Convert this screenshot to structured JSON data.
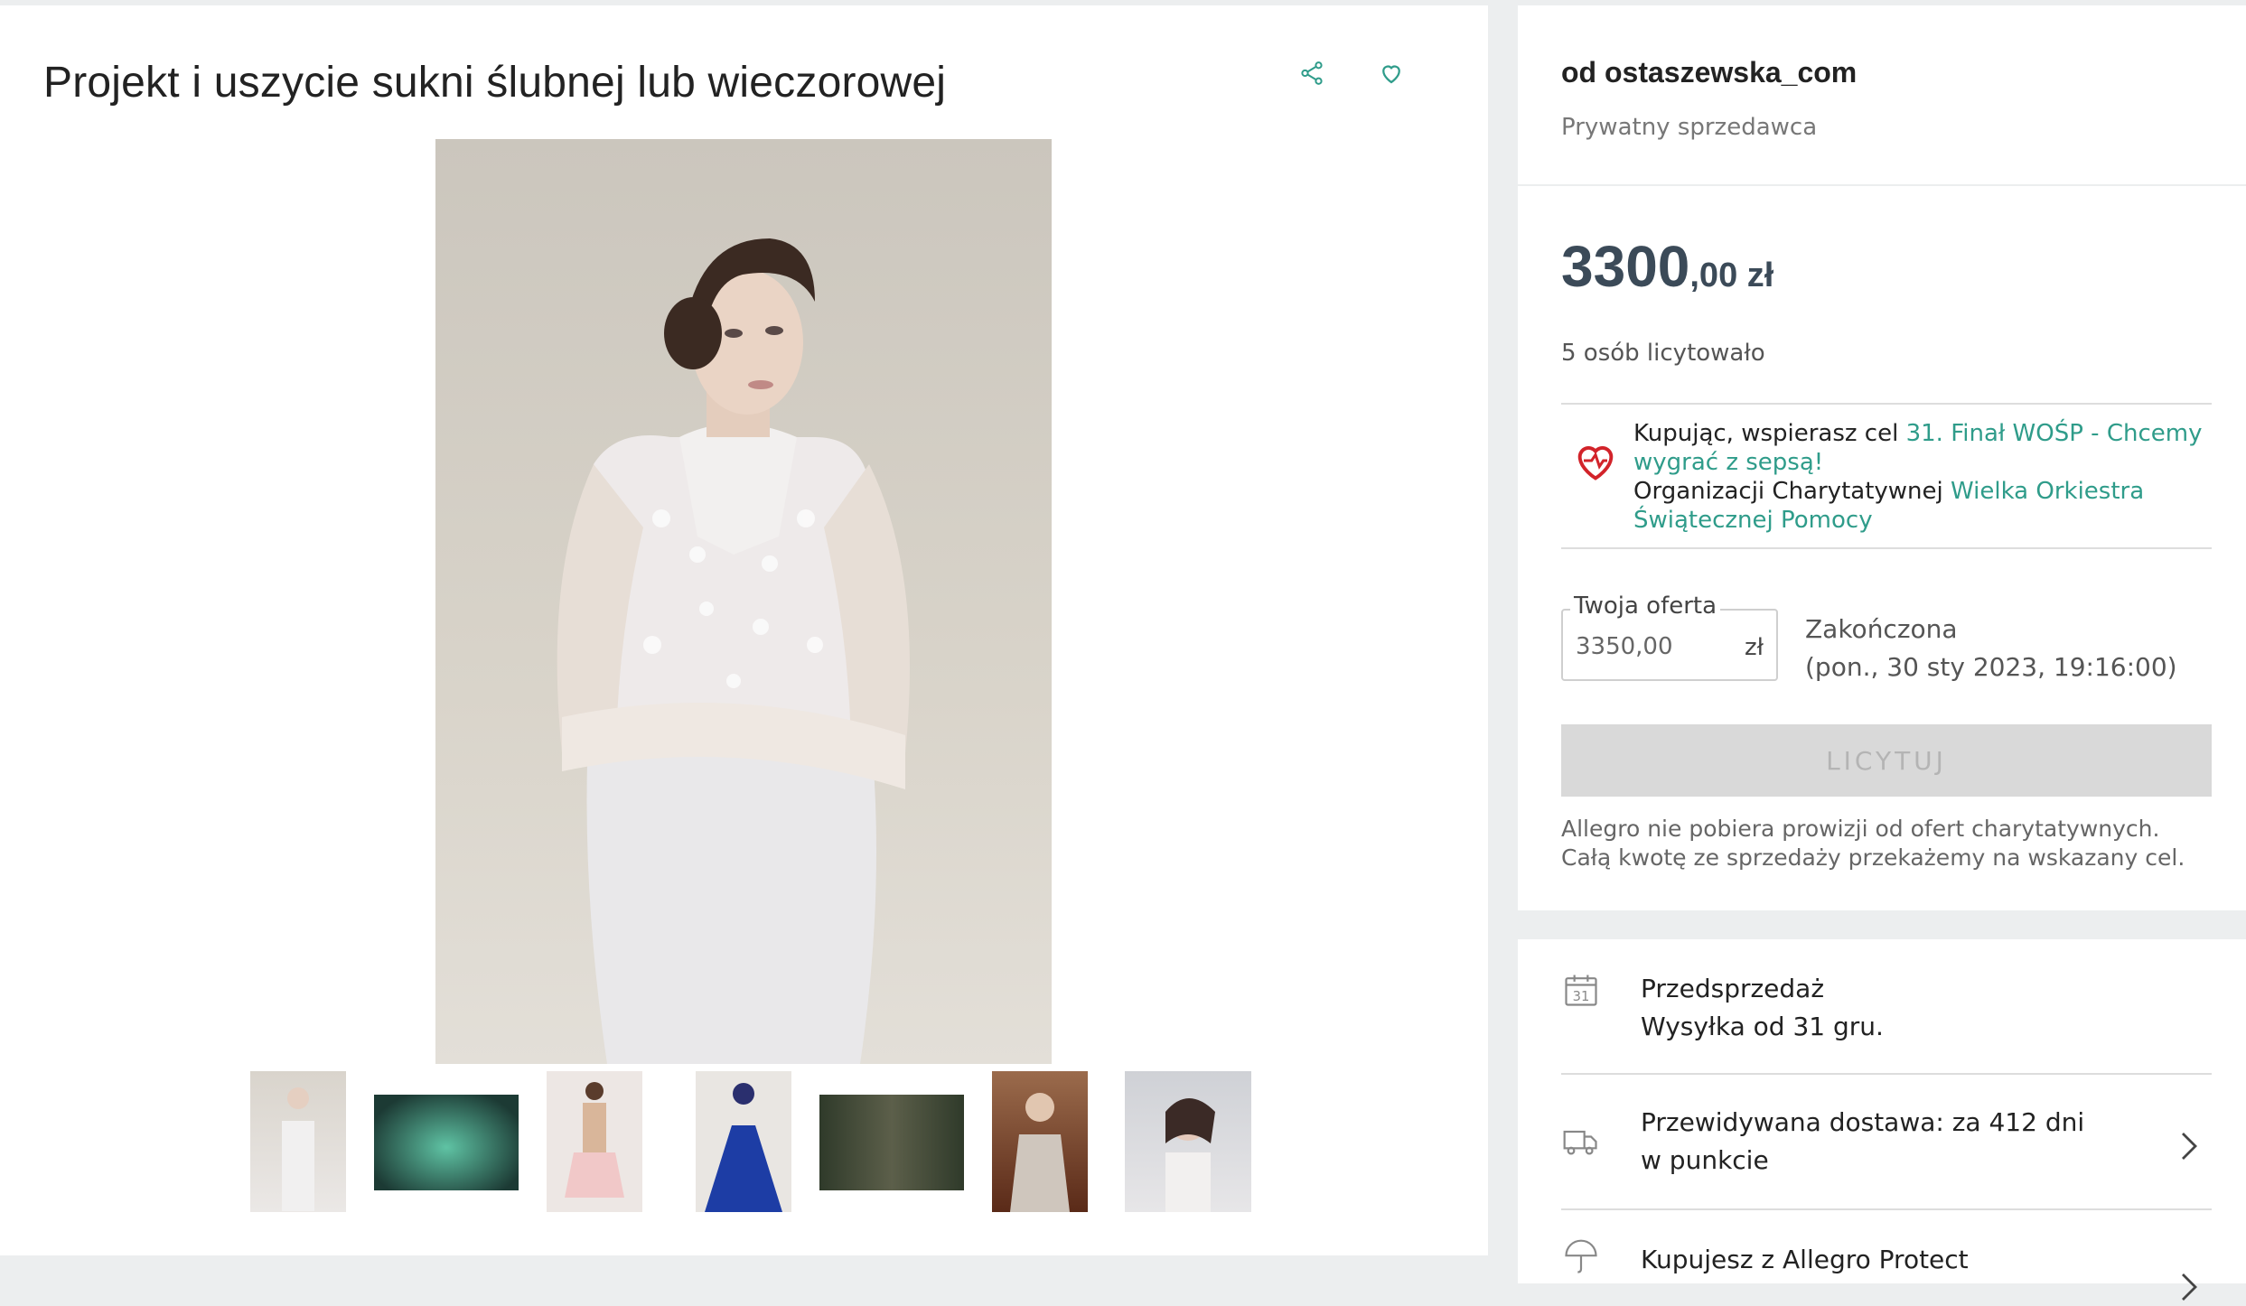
{
  "listing": {
    "title": "Projekt i uszycie sukni ślubnej lub wieczorowej",
    "icons": [
      "share-icon",
      "heart-outline-icon"
    ],
    "thumbnails_count": 7
  },
  "seller": {
    "name": "od ostaszewska_com",
    "type": "Prywatny sprzedawca"
  },
  "offer": {
    "price_int": "3300",
    "price_frac": ",00 zł",
    "bidders": "5 osób licytowało",
    "charity_prefix": "Kupując, wspierasz cel ",
    "charity_goal": "31. Finał WOŚP - Chcemy wygrać z sepsą!",
    "charity_org_prefix": "Organizacji Charytatywnej ",
    "charity_org": "Wielka Orkiestra Świątecznej Pomocy",
    "bid_label": "Twoja oferta",
    "bid_value": "3350,00",
    "bid_currency": "zł",
    "status": "Zakończona",
    "end_date": "(pon., 30 sty 2023, 19:16:00)",
    "bid_button": "LICYTUJ",
    "note": "Allegro nie pobiera prowizji od ofert charytatywnych. Całą kwotę ze sprzedaży przekażemy na wskazany cel."
  },
  "delivery": {
    "presale_title": "Przedsprzedaż",
    "presale_sub": "Wysyłka od 31 gru.",
    "presale_icon_day": "31",
    "eta": "Przewidywana dostawa: za 412 dni w punkcie",
    "protect": "Kupujesz z Allegro Protect"
  },
  "colors": {
    "accent": "#2f9c8a",
    "price": "#3b4a58",
    "heart": "#d2232a"
  }
}
